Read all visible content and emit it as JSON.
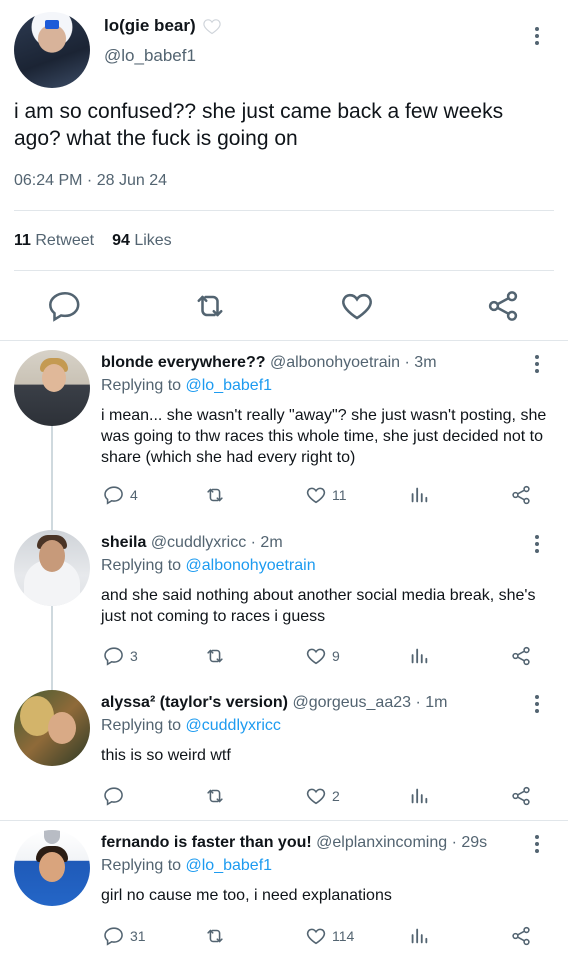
{
  "main_tweet": {
    "display_name": "lo(gie bear)",
    "handle": "@lo_babef1",
    "text": "i am so confused?? she just came back a few weeks ago? what the fuck is going on",
    "timestamp": "06:24 PM · 28 Jun 24",
    "retweets_count": "11",
    "retweets_label": "Retweet",
    "likes_count": "94",
    "likes_label": "Likes",
    "badge_icon": "white-heart-icon"
  },
  "replying_prefix": "Replying to",
  "replies": [
    {
      "display_name": "blonde everywhere??",
      "handle": "@albonohyoetrain",
      "time": "· 3m",
      "replying_to": "@lo_babef1",
      "text": "i mean... she wasn't really \"away\"? she just wasn't posting, she was going to thw races this whole time, she just decided not to share (which she had every right to)",
      "reply_count": "4",
      "retweet_count": "",
      "like_count": "11"
    },
    {
      "display_name": "sheila",
      "handle": "@cuddlyxricc",
      "time": "· 2m",
      "replying_to": "@albonohyoetrain",
      "text": "and she said nothing about another social media break, she's just not coming to races i guess",
      "reply_count": "3",
      "retweet_count": "",
      "like_count": "9"
    },
    {
      "display_name": "alyssa² (taylor's version)",
      "handle": "@gorgeus_aa23",
      "time": "· 1m",
      "replying_to": "@cuddlyxricc",
      "text": "this is so weird wtf",
      "reply_count": "",
      "retweet_count": "",
      "like_count": "2"
    },
    {
      "display_name": "fernando is faster than you!",
      "handle": "@elplanxincoming",
      "time": "· 29s",
      "replying_to": "@lo_babef1",
      "text": "girl no cause me too, i need explanations",
      "reply_count": "31",
      "retweet_count": "",
      "like_count": "114"
    }
  ],
  "colors": {
    "text": "#0f1419",
    "muted": "#536471",
    "link": "#1d9bf0",
    "divider": "#e1e6ea",
    "thread_line": "#cfd9de"
  }
}
